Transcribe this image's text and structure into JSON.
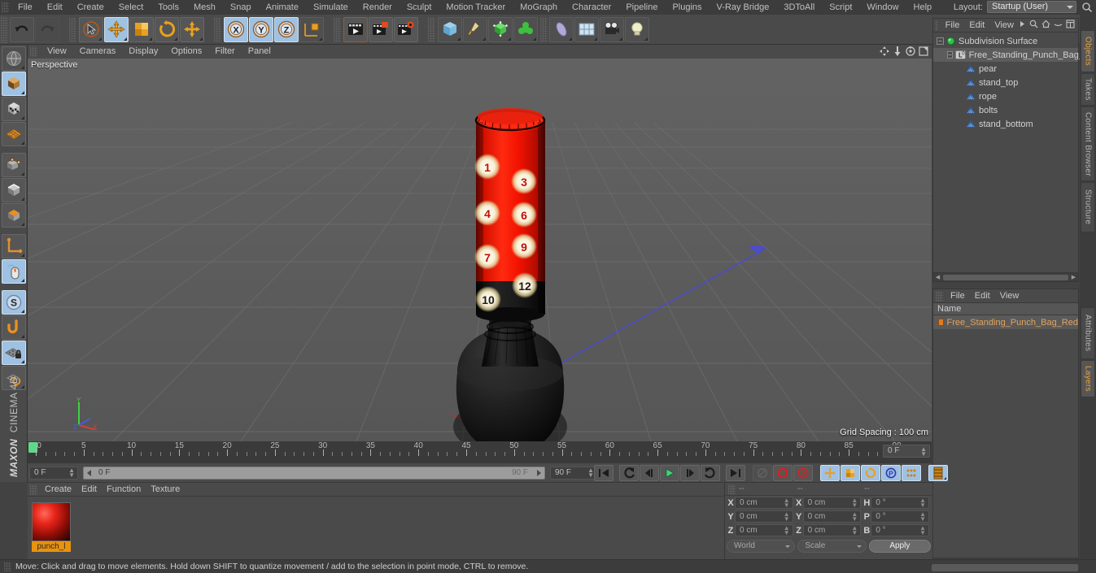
{
  "app": {
    "title": "MAXON CINEMA 4D",
    "brand_bold": "MAXON",
    "brand_rest": "CINEMA 4D"
  },
  "menubar": {
    "items": [
      "File",
      "Edit",
      "Create",
      "Select",
      "Tools",
      "Mesh",
      "Snap",
      "Animate",
      "Simulate",
      "Render",
      "Sculpt",
      "Motion Tracker",
      "MoGraph",
      "Character",
      "Pipeline",
      "Plugins",
      "V-Ray Bridge",
      "3DToAll",
      "Script",
      "Window",
      "Help"
    ],
    "layout_label": "Layout:",
    "layout_value": "Startup (User)",
    "search_icon": "search-icon"
  },
  "toolbar": {
    "groups": [
      {
        "name": "history",
        "buttons": [
          {
            "name": "undo-button",
            "icon": "undo-arrow-icon",
            "selected": false,
            "enabled": true
          },
          {
            "name": "redo-button",
            "icon": "redo-arrow-icon",
            "selected": false,
            "enabled": false
          }
        ]
      },
      {
        "name": "transform",
        "buttons": [
          {
            "name": "live-selection-tool",
            "icon": "cursor-circle-icon",
            "selected": false
          },
          {
            "name": "move-tool",
            "icon": "move-arrows-icon",
            "selected": true
          },
          {
            "name": "scale-tool",
            "icon": "scale-box-icon",
            "selected": false
          },
          {
            "name": "rotate-tool",
            "icon": "rotate-ring-icon",
            "selected": false
          },
          {
            "name": "axis-modify-tool",
            "icon": "plus-axis-icon",
            "selected": false
          }
        ]
      },
      {
        "name": "axis-locks",
        "buttons": [
          {
            "name": "lock-x-axis",
            "icon": "x-axis-icon",
            "label": "X",
            "selected": true
          },
          {
            "name": "lock-y-axis",
            "icon": "y-axis-icon",
            "label": "Y",
            "selected": true
          },
          {
            "name": "lock-z-axis",
            "icon": "z-axis-icon",
            "label": "Z",
            "selected": true
          },
          {
            "name": "world-object-coords",
            "icon": "world-axis-cube-icon",
            "selected": false
          }
        ]
      },
      {
        "name": "render",
        "buttons": [
          {
            "name": "render-view-button",
            "icon": "clapperboard-icon",
            "selected": false
          },
          {
            "name": "render-to-picture-viewer-button",
            "icon": "clapperboard-picture-icon",
            "selected": false
          },
          {
            "name": "render-settings-button",
            "icon": "clapperboard-gear-icon",
            "selected": false
          }
        ]
      },
      {
        "name": "creation",
        "buttons": [
          {
            "name": "add-cube-primitive",
            "icon": "cube-icon",
            "selected": false
          },
          {
            "name": "add-spline",
            "icon": "pen-spline-icon",
            "selected": false
          },
          {
            "name": "add-generator",
            "icon": "green-cube-generator-icon",
            "selected": false
          },
          {
            "name": "add-array",
            "icon": "green-cluster-icon",
            "selected": false
          },
          {
            "name": "add-deformer",
            "icon": "bend-deformer-icon",
            "selected": false
          },
          {
            "name": "add-environment",
            "icon": "floor-sky-icon",
            "selected": false
          },
          {
            "name": "add-camera",
            "icon": "camera-icon",
            "selected": false
          },
          {
            "name": "add-light",
            "icon": "light-bulb-icon",
            "selected": false
          }
        ]
      }
    ]
  },
  "left_toolbar": {
    "buttons": [
      {
        "name": "make-editable-button",
        "icon": "globe-mesh-icon",
        "selected": false
      },
      {
        "name": "model-mode-button",
        "icon": "model-cube-icon",
        "selected": true
      },
      {
        "name": "texture-mode-button",
        "icon": "texture-checker-cube-icon",
        "selected": false
      },
      {
        "name": "workplane-mode-button",
        "icon": "orange-grid-plane-icon",
        "selected": false
      },
      {
        "name": "points-mode-button",
        "icon": "points-cube-icon",
        "selected": false
      },
      {
        "name": "edges-mode-button",
        "icon": "edges-cube-icon",
        "selected": false
      },
      {
        "name": "polygons-mode-button",
        "icon": "polygon-cube-icon",
        "selected": false
      },
      {
        "name": "object-axis-button",
        "icon": "axis-L-icon",
        "selected": false
      },
      {
        "name": "viewport-solo-button",
        "icon": "mouse-icon",
        "selected": true
      },
      {
        "name": "snap-toggle-button",
        "icon": "s-circle-icon",
        "selected": true
      },
      {
        "name": "enable-snapping-button",
        "icon": "orange-hook-icon",
        "selected": false
      },
      {
        "name": "workplane-lock-button",
        "icon": "grid-lock-icon",
        "selected": true
      },
      {
        "name": "workplane-reset-button",
        "icon": "grid-rotate-icon",
        "selected": false
      }
    ]
  },
  "viewport": {
    "menu_items": [
      "View",
      "Cameras",
      "Display",
      "Options",
      "Filter",
      "Panel"
    ],
    "nav_icons": [
      "pan-icon",
      "dolly-icon",
      "orbit-icon",
      "maximize-icon"
    ],
    "label": "Perspective",
    "grid_spacing": "Grid Spacing : 100 cm",
    "scene": {
      "object": "Free Standing Punch Bag Red",
      "bag_color": "#f21100",
      "base_color": "#141414",
      "target_numbers": [
        "1",
        "3",
        "4",
        "6",
        "7",
        "9",
        "10",
        "12"
      ]
    }
  },
  "object_manager": {
    "menu": [
      "File",
      "Edit",
      "View"
    ],
    "menu_icons": [
      "chevron-right-icon",
      "search-icon",
      "home-icon",
      "minimize-icon",
      "fit-icon"
    ],
    "tree": [
      {
        "label": "Subdivision Surface",
        "depth": 0,
        "icon": "subdivision-surface-icon",
        "selected": false,
        "expandable": true
      },
      {
        "label": "Free_Standing_Punch_Bag_Red",
        "depth": 1,
        "icon": "null-object-icon",
        "selected": true,
        "expandable": true
      },
      {
        "label": "pear",
        "depth": 2,
        "icon": "polygon-object-icon",
        "selected": false,
        "expandable": false
      },
      {
        "label": "stand_top",
        "depth": 2,
        "icon": "polygon-object-icon",
        "selected": false,
        "expandable": false
      },
      {
        "label": "rope",
        "depth": 2,
        "icon": "polygon-object-icon",
        "selected": false,
        "expandable": false
      },
      {
        "label": "bolts",
        "depth": 2,
        "icon": "polygon-object-icon",
        "selected": false,
        "expandable": false
      },
      {
        "label": "stand_bottom",
        "depth": 2,
        "icon": "polygon-object-icon",
        "selected": false,
        "expandable": false
      }
    ]
  },
  "layer_manager": {
    "menu": [
      "File",
      "Edit",
      "View"
    ],
    "column_header": "Name",
    "rows": [
      {
        "label": "Free_Standing_Punch_Bag_Red",
        "color": "#e07b20"
      }
    ]
  },
  "vertical_tabs": [
    {
      "label": "Objects",
      "active": true
    },
    {
      "label": "Takes",
      "active": false
    },
    {
      "label": "Content Browser",
      "active": false
    },
    {
      "label": "Structure",
      "active": false
    },
    {
      "label": "Attributes",
      "active": false
    },
    {
      "label": "Layers",
      "active": true
    }
  ],
  "timeline": {
    "ticks": [
      0,
      5,
      10,
      15,
      20,
      25,
      30,
      35,
      40,
      45,
      50,
      55,
      60,
      65,
      70,
      75,
      80,
      85,
      90
    ],
    "range_start": 0,
    "range_end": 90,
    "current_frame": "0 F",
    "end_field": "0 F"
  },
  "animbar": {
    "current_frame_field": "0 F",
    "track_start_label": "0 F",
    "track_end_label": "90 F",
    "preview_end_field": "90 F",
    "buttons": [
      {
        "name": "go-to-start-button",
        "icon": "skip-start-icon",
        "selected": false
      },
      {
        "name": "previous-key-button",
        "icon": "rewind-key-icon",
        "selected": false
      },
      {
        "name": "step-back-button",
        "icon": "step-back-icon",
        "selected": false
      },
      {
        "name": "play-button",
        "icon": "play-icon",
        "selected": false
      },
      {
        "name": "step-forward-button",
        "icon": "step-forward-icon",
        "selected": false
      },
      {
        "name": "next-key-button",
        "icon": "forward-key-icon",
        "selected": false
      },
      {
        "name": "go-to-end-button",
        "icon": "skip-end-icon",
        "selected": false
      },
      {
        "name": "record-active-objects-button",
        "icon": "record-disabled-icon",
        "selected": false
      },
      {
        "name": "autokeying-button",
        "icon": "keyframe-red-icon",
        "selected": false
      },
      {
        "name": "keyframe-selection-button",
        "icon": "question-red-icon",
        "selected": false
      },
      {
        "name": "position-key-button",
        "icon": "move-arrows-icon",
        "selected": true
      },
      {
        "name": "scale-key-button",
        "icon": "scale-box-icon",
        "selected": true
      },
      {
        "name": "rotation-key-button",
        "icon": "rotate-ring-icon",
        "selected": true
      },
      {
        "name": "param-key-button",
        "icon": "p-circle-icon",
        "selected": true
      },
      {
        "name": "pla-key-button",
        "icon": "point-level-anim-icon",
        "selected": true
      },
      {
        "name": "timeline-toggle-button",
        "icon": "timeline-icon",
        "selected": true
      }
    ]
  },
  "material_manager": {
    "menu": [
      "Create",
      "Edit",
      "Function",
      "Texture"
    ],
    "materials": [
      {
        "name": "punch_l",
        "color": "#e8251a"
      }
    ]
  },
  "coordinates": {
    "col_headers": [
      "--",
      "--",
      "--"
    ],
    "rows": [
      {
        "label": "X",
        "position": "0 cm",
        "size": "0 cm",
        "rot_label": "H",
        "rotation": "0 °"
      },
      {
        "label": "Y",
        "position": "0 cm",
        "size": "0 cm",
        "rot_label": "P",
        "rotation": "0 °"
      },
      {
        "label": "Z",
        "position": "0 cm",
        "size": "0 cm",
        "rot_label": "B",
        "rotation": "0 °"
      }
    ],
    "coord_system": "World",
    "mode": "Scale",
    "apply_label": "Apply"
  },
  "statusbar": {
    "message": "Move: Click and drag to move elements. Hold down SHIFT to quantize movement / add to the selection in point mode, CTRL to remove."
  }
}
